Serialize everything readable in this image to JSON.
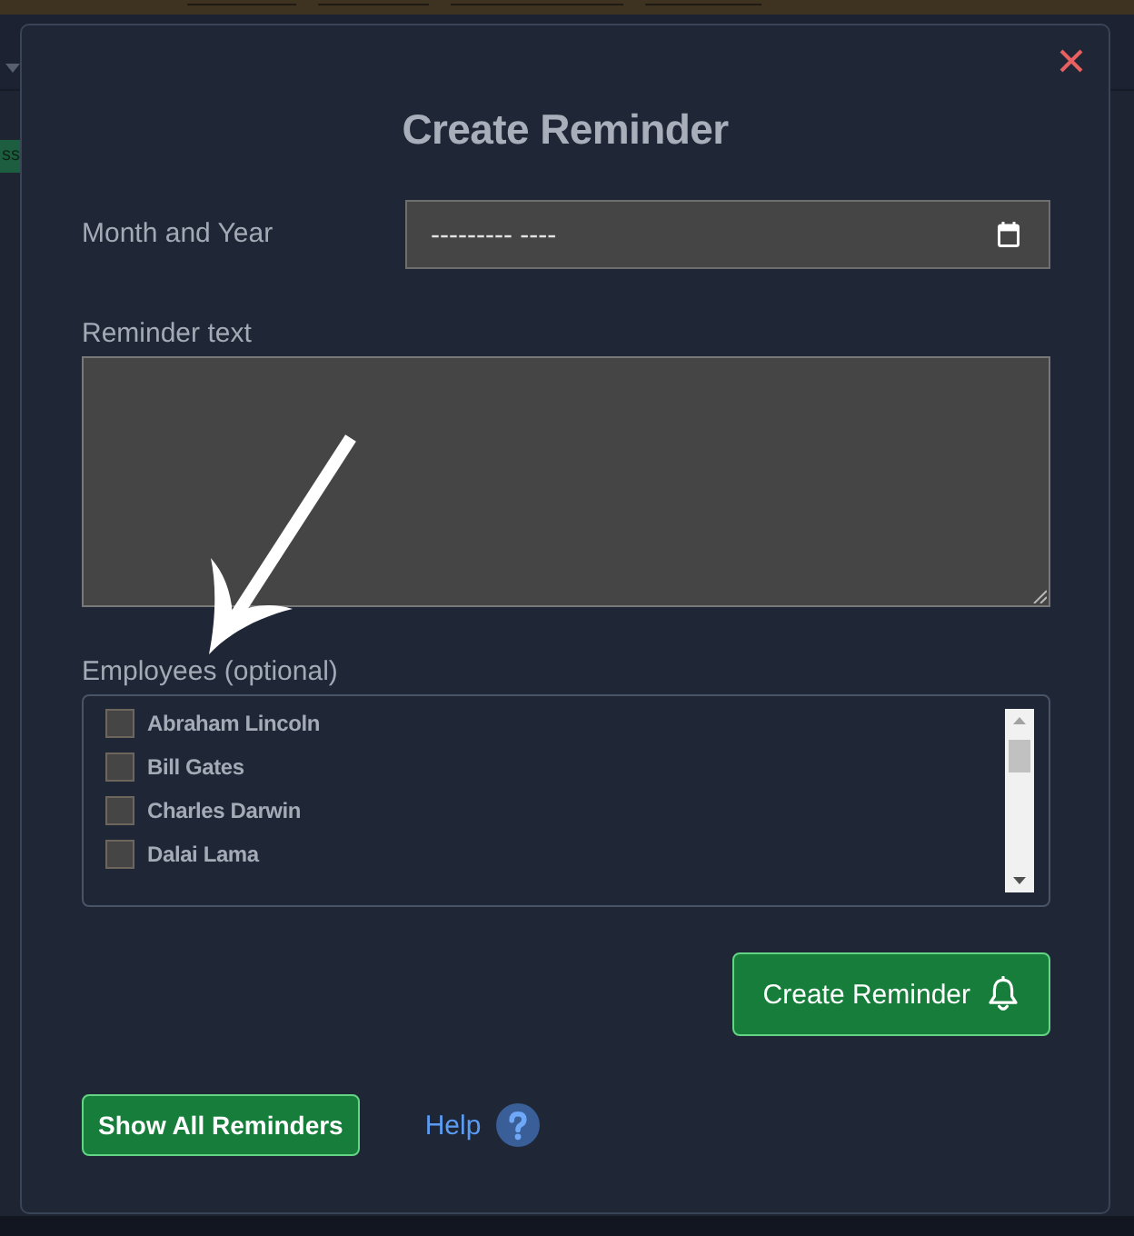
{
  "background": {
    "badge_text": "ss"
  },
  "dialog": {
    "title": "Create Reminder",
    "fields": [
      {
        "kind": "month",
        "label": "Month and Year",
        "placeholder": "--------- ----"
      },
      {
        "kind": "textarea",
        "label": "Reminder text"
      }
    ],
    "employees": {
      "label": "Employees (optional)",
      "items": [
        {
          "name": "Abraham Lincoln",
          "checked": false
        },
        {
          "name": "Bill Gates",
          "checked": false
        },
        {
          "name": "Charles Darwin",
          "checked": false
        },
        {
          "name": "Dalai Lama",
          "checked": false
        }
      ]
    },
    "create_button": {
      "label": "Create Reminder"
    },
    "footer": {
      "show_all_button": {
        "label": "Show All Reminders"
      },
      "help_link": {
        "label": "Help"
      }
    }
  }
}
